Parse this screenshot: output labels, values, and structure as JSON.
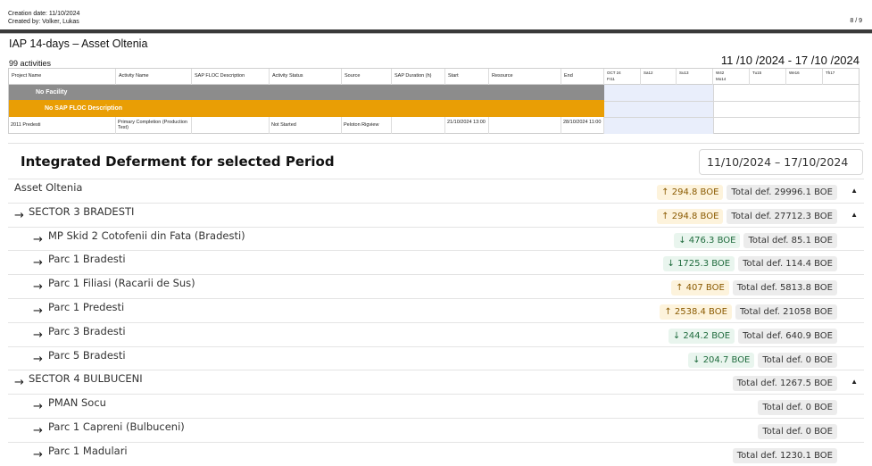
{
  "header": {
    "creation_date": "Creation date: 11/10/2024",
    "created_by": "Created by: Volker, Lukas",
    "page_number": "8 / 9"
  },
  "report": {
    "title": "IAP 14-days – Asset Oltenia",
    "date_range": "11 /10 /2024 - 17 /10 /2024",
    "activity_count": "99 activities"
  },
  "gantt": {
    "columns": [
      "Project Name",
      "Activity Name",
      "SAP FLOC Description",
      "Activity Status",
      "Source",
      "SAP Duration (h)",
      "Start",
      "Resource",
      "End"
    ],
    "days": [
      {
        "top": "OCT 24",
        "bottom": "Fr11"
      },
      {
        "top": "",
        "bottom": "Sa12"
      },
      {
        "top": "",
        "bottom": "Su13"
      },
      {
        "top": "W42",
        "bottom": "Mo14"
      },
      {
        "top": "",
        "bottom": "Tu15"
      },
      {
        "top": "",
        "bottom": "We16"
      },
      {
        "top": "",
        "bottom": "Th17"
      }
    ],
    "group_facility": "No Facility",
    "group_floc": "No SAP FLOC Description",
    "row": {
      "project": "2011  Predesti",
      "activity": "Primary Completion (Production Test)",
      "floc": "",
      "status": "Not Started",
      "source": "Peloton Rigview",
      "duration": "",
      "start": "21/10/2024 13:00",
      "resource": "",
      "end": "28/10/2024 11:00"
    }
  },
  "deferment": {
    "title": "Integrated Deferment for selected Period",
    "date_picker_value": "11/10/2024 – 17/10/2024",
    "rows": [
      {
        "label": "Asset Oltenia",
        "arrow": "",
        "change": "↑ 294.8 BOE",
        "dir": "up",
        "total": "Total def. 29996.1 BOE",
        "caret": "▲"
      },
      {
        "label": "SECTOR 3 BRADESTI",
        "arrow": "→",
        "change": "↑ 294.8 BOE",
        "dir": "up",
        "total": "Total def. 27712.3 BOE",
        "caret": "▲"
      },
      {
        "label": "MP Skid 2 Cotofenii din Fata (Bradesti)",
        "arrow": "→",
        "change": "↓ 476.3 BOE",
        "dir": "down",
        "total": "Total def. 85.1 BOE",
        "caret": ""
      },
      {
        "label": "Parc 1 Bradesti",
        "arrow": "→",
        "change": "↓ 1725.3 BOE",
        "dir": "down",
        "total": "Total def. 114.4 BOE",
        "caret": ""
      },
      {
        "label": "Parc 1 Filiasi (Racarii de Sus)",
        "arrow": "→",
        "change": "↑ 407 BOE",
        "dir": "up",
        "total": "Total def. 5813.8 BOE",
        "caret": ""
      },
      {
        "label": "Parc 1 Predesti",
        "arrow": "→",
        "change": "↑ 2538.4 BOE",
        "dir": "up",
        "total": "Total def. 21058 BOE",
        "caret": ""
      },
      {
        "label": "Parc 3 Bradesti",
        "arrow": "→",
        "change": "↓ 244.2 BOE",
        "dir": "down",
        "total": "Total def. 640.9 BOE",
        "caret": ""
      },
      {
        "label": "Parc 5 Bradesti",
        "arrow": "→",
        "change": "↓ 204.7 BOE",
        "dir": "down",
        "total": "Total def. 0 BOE",
        "caret": ""
      },
      {
        "label": "SECTOR 4 BULBUCENI",
        "arrow": "→",
        "change": "",
        "dir": "",
        "total": "Total def. 1267.5 BOE",
        "caret": "▲"
      },
      {
        "label": "PMAN Socu",
        "arrow": "→",
        "change": "",
        "dir": "",
        "total": "Total def. 0 BOE",
        "caret": ""
      },
      {
        "label": "Parc 1 Capreni (Bulbuceni)",
        "arrow": "→",
        "change": "",
        "dir": "",
        "total": "Total def. 0 BOE",
        "caret": ""
      },
      {
        "label": "Parc 1 Madulari",
        "arrow": "→",
        "change": "",
        "dir": "",
        "total": "Total def. 1230.1 BOE",
        "caret": ""
      }
    ]
  }
}
